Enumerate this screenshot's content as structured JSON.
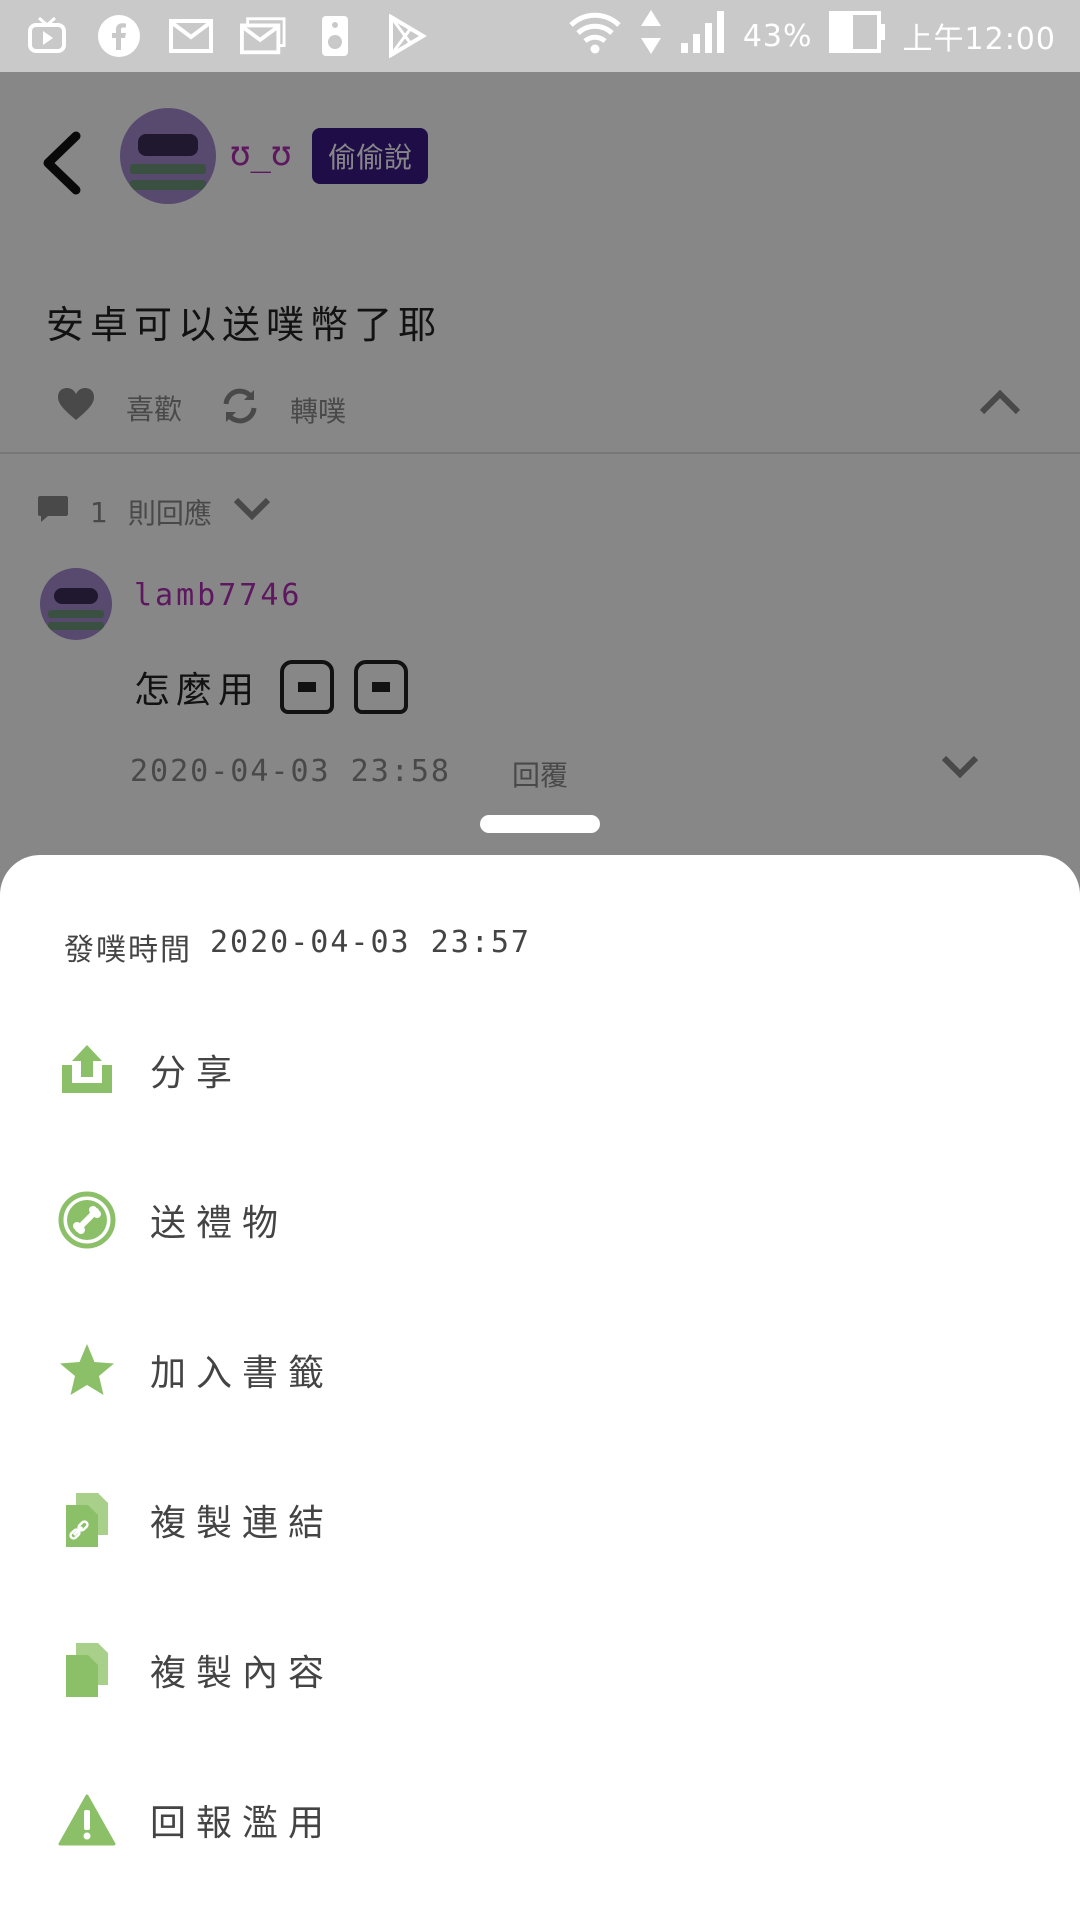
{
  "status_bar": {
    "battery": "43%",
    "time": "上午12:00"
  },
  "post": {
    "author": "ʊ_ʊ",
    "badge": "偷偷說",
    "content": "安卓可以送噗幣了耶",
    "like_label": "喜歡",
    "replurk_label": "轉噗",
    "response_count": "1",
    "response_label": "則回應"
  },
  "reply": {
    "author": "lamb7746",
    "content": "怎麼用",
    "timestamp": "2020-04-03 23:58",
    "reply_label": "回覆"
  },
  "sheet": {
    "post_time_label": "發噗時間",
    "post_time_value": "2020-04-03 23:57",
    "menu": [
      {
        "label": "分享",
        "icon": "share-icon"
      },
      {
        "label": "送禮物",
        "icon": "gift-icon"
      },
      {
        "label": "加入書籤",
        "icon": "star-icon"
      },
      {
        "label": "複製連結",
        "icon": "copy-link-icon"
      },
      {
        "label": "複製內容",
        "icon": "copy-content-icon"
      },
      {
        "label": "回報濫用",
        "icon": "warning-icon"
      }
    ]
  },
  "colors": {
    "accent_green": "#8cc068",
    "username_purple": "#b02fb3",
    "badge_bg": "#3c1a86"
  }
}
